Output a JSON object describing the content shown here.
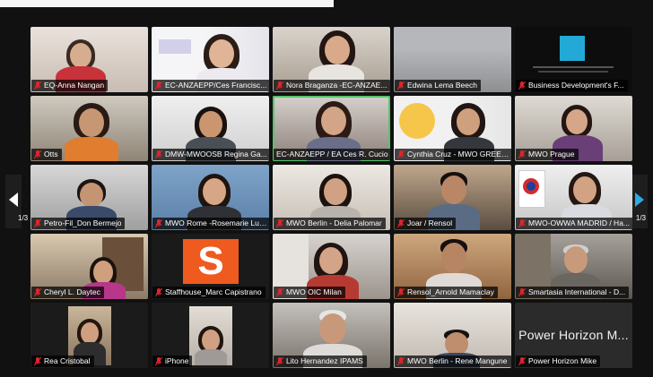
{
  "pagination": {
    "left": "1/3",
    "right": "1/3"
  },
  "tiles": [
    {
      "name": "EQ-Anna Nangan"
    },
    {
      "name": "EC-ANZAEPP/Ces Francisc..."
    },
    {
      "name": "Nora Braganza -EC-ANZAE..."
    },
    {
      "name": "Edwina Lema Beech"
    },
    {
      "name": "Business Development's F..."
    },
    {
      "name": "Otts"
    },
    {
      "name": "DMW-MWOOSB Regina Ga..."
    },
    {
      "name": "EC-ANZAEPP / EA Ces R. Cucio"
    },
    {
      "name": "Cynthia Cruz - MWO GREECE"
    },
    {
      "name": "MWO Prague"
    },
    {
      "name": "Petro-Fil_Don Bermejo"
    },
    {
      "name": "MWO Rome -Rosemarie Luntao"
    },
    {
      "name": "MWO Berlin - Delia Palomar"
    },
    {
      "name": "Joar / Rensol"
    },
    {
      "name": "MWO-OWWA MADRID / Ha..."
    },
    {
      "name": "Cheryl L. Daytec"
    },
    {
      "name": "Staffhouse_Marc Capistrano"
    },
    {
      "name": "MWO OIC Milan"
    },
    {
      "name": "Rensol_Arnold Mamaclay"
    },
    {
      "name": "Smartasia International - D..."
    },
    {
      "name": "Rea Cristobal"
    },
    {
      "name": "iPhone"
    },
    {
      "name": "Lito Hernandez IPAMS"
    },
    {
      "name": "MWO Berlin - Rene Mangune"
    },
    {
      "name": "Power Horizon Mike",
      "display_text": "Power Horizon M..."
    }
  ]
}
